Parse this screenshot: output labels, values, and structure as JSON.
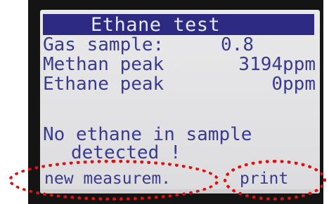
{
  "screen": {
    "title": "Ethane test",
    "rows": [
      {
        "label": "Gas sample:",
        "value": "0.8"
      },
      {
        "label": "Methan peak",
        "value": "3194ppm"
      },
      {
        "label": "Ethane peak",
        "value": "0ppm"
      }
    ],
    "message": {
      "line1": "No ethane in sample",
      "line2": "detected !"
    },
    "softkeys": {
      "left": "new measurem.",
      "right": "print"
    }
  },
  "colors": {
    "title_bar": "#2c2a82",
    "lcd_text": "#3a3a8e",
    "annotation": "#e01010"
  }
}
